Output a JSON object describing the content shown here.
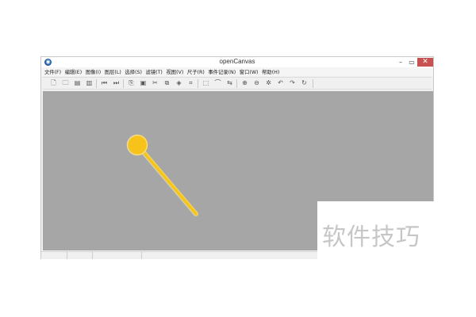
{
  "window": {
    "title": "openCanvas",
    "logo_glyph": "◉",
    "minimize_glyph": "–",
    "maximize_glyph": "▭",
    "close_glyph": "✕"
  },
  "menu": {
    "items": [
      "文件(F)",
      "编辑(E)",
      "图像(I)",
      "图层(L)",
      "选择(S)",
      "滤镜(T)",
      "视图(V)",
      "尺子(R)",
      "事件记录(N)",
      "窗口(W)",
      "帮助(H)"
    ]
  },
  "toolbar": {
    "icons": [
      {
        "name": "new-file-icon",
        "glyph": "🗋"
      },
      {
        "name": "open-folder-icon",
        "glyph": "🗀"
      },
      {
        "name": "save-icon",
        "glyph": "▤"
      },
      {
        "name": "save-as-icon",
        "glyph": "▥"
      },
      {
        "name": "first-page-icon",
        "glyph": "⏮"
      },
      {
        "name": "last-page-icon",
        "glyph": "⏭"
      },
      {
        "name": "copy-icon",
        "glyph": "⎘"
      },
      {
        "name": "paste-icon",
        "glyph": "▣"
      },
      {
        "name": "cut-icon",
        "glyph": "✂"
      },
      {
        "name": "duplicate-icon",
        "glyph": "⧉"
      },
      {
        "name": "fill-icon",
        "glyph": "◈"
      },
      {
        "name": "crop-icon",
        "glyph": "⌗"
      },
      {
        "name": "select-rect-icon",
        "glyph": "⬚"
      },
      {
        "name": "lasso-icon",
        "glyph": "⌒"
      },
      {
        "name": "mirror-icon",
        "glyph": "⇆"
      },
      {
        "name": "zoom-in-icon",
        "glyph": "⊕"
      },
      {
        "name": "zoom-out-icon",
        "glyph": "⊖"
      },
      {
        "name": "zoom-fit-icon",
        "glyph": "✲"
      },
      {
        "name": "undo-icon",
        "glyph": "↶"
      },
      {
        "name": "redo-icon",
        "glyph": "↷"
      },
      {
        "name": "rotate-icon",
        "glyph": "↻"
      }
    ]
  },
  "canvas": {
    "background": "#a6a6a6",
    "stroke_color": "#f5c518",
    "stroke_outline": "#e8d28a"
  },
  "watermark": {
    "text": "软件技巧"
  }
}
